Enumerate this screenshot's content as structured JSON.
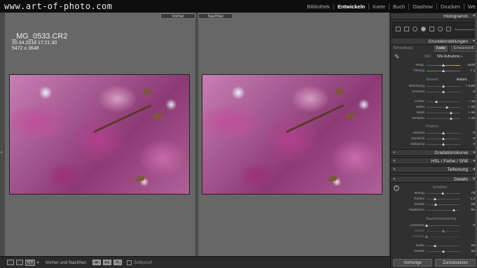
{
  "app": {
    "logo": "www.art-of-photo.com",
    "modules": [
      "Bibliothek",
      "Entwickeln",
      "Karte",
      "Buch",
      "Diashow",
      "Drucken",
      "We"
    ],
    "active_module": "Entwickeln"
  },
  "views": {
    "before_label": "Vorher",
    "after_label": "Nachher"
  },
  "file": {
    "name": "_MG_0533.CR2",
    "date": "20.04.2018 17:21:30",
    "dimensions": "5472 x 3648"
  },
  "toolbar": {
    "view_yy": "Y|Y",
    "caret": "▾",
    "before_after_label": "Vorher und Nachher:",
    "btn1": "◂▸",
    "btn2": "▸◂",
    "btn3": "⇅",
    "softproof_label": "Softproof"
  },
  "panels": {
    "histogram": "Histogramm",
    "basic": "Grundeinstellungen",
    "tone_curve": "Gradationskurve",
    "hsl": "HSL",
    "hsl_sep1": "/",
    "farbe": "Farbe",
    "hsl_sep2": "/",
    "sw": "S/W",
    "split_toning": "Teiltonung",
    "details": "Details"
  },
  "basic": {
    "treatment_label": "Behandlung:",
    "treatment_color": "Farbe",
    "treatment_bw": "Schwarzweiß",
    "wb_label": "WA :",
    "wb_value": "Wie Aufnahme ÷",
    "temp": {
      "label": "Temp.",
      "value": "4100",
      "pos": 0.5
    },
    "tint": {
      "label": "Tönung",
      "value": "+ 1",
      "pos": 0.5
    },
    "tone_label": "Tonwert",
    "auto_label": "Autom.",
    "exposure": {
      "label": "Belichtung",
      "value": "+ 0,00",
      "pos": 0.5
    },
    "contrast": {
      "label": "Kontrast",
      "value": "0",
      "pos": 0.5
    },
    "highlights": {
      "label": "Lichter",
      "value": "− 42",
      "pos": 0.29
    },
    "shadows": {
      "label": "Tiefen",
      "value": "+ 22",
      "pos": 0.61
    },
    "whites": {
      "label": "Weiß",
      "value": "+ 46",
      "pos": 0.73
    },
    "blacks": {
      "label": "Schwarz",
      "value": "+ 44",
      "pos": 0.72
    },
    "presence_label": "Präsenz",
    "clarity": {
      "label": "Klarheit",
      "value": "0",
      "pos": 0.5
    },
    "vibrance": {
      "label": "Dynamik",
      "value": "0",
      "pos": 0.5
    },
    "saturation": {
      "label": "Sättigung",
      "value": "0",
      "pos": 0.5
    }
  },
  "details": {
    "sharpening_label": "Schärfen",
    "amount": {
      "label": "Betrag",
      "value": "73",
      "pos": 0.48
    },
    "radius": {
      "label": "Radius",
      "value": "1,3",
      "pos": 0.25
    },
    "detail": {
      "label": "Details",
      "value": "28",
      "pos": 0.28
    },
    "masking": {
      "label": "Maskieren",
      "value": "81",
      "pos": 0.81
    },
    "noise_label": "Rauschreduzierung",
    "luminance": {
      "label": "Luminanz",
      "value": "0",
      "pos": 0.0
    },
    "lum_detail": {
      "label": "Details",
      "value": "",
      "pos": 0.5
    },
    "lum_contrast": {
      "label": "Kontrast",
      "value": "",
      "pos": 0.0
    },
    "color": {
      "label": "Farbe",
      "value": "25",
      "pos": 0.25
    },
    "color_detail": {
      "label": "Details",
      "value": "50",
      "pos": 0.5
    }
  },
  "buttons": {
    "previous": "Vorherige",
    "reset": "Zurücksetzen"
  }
}
